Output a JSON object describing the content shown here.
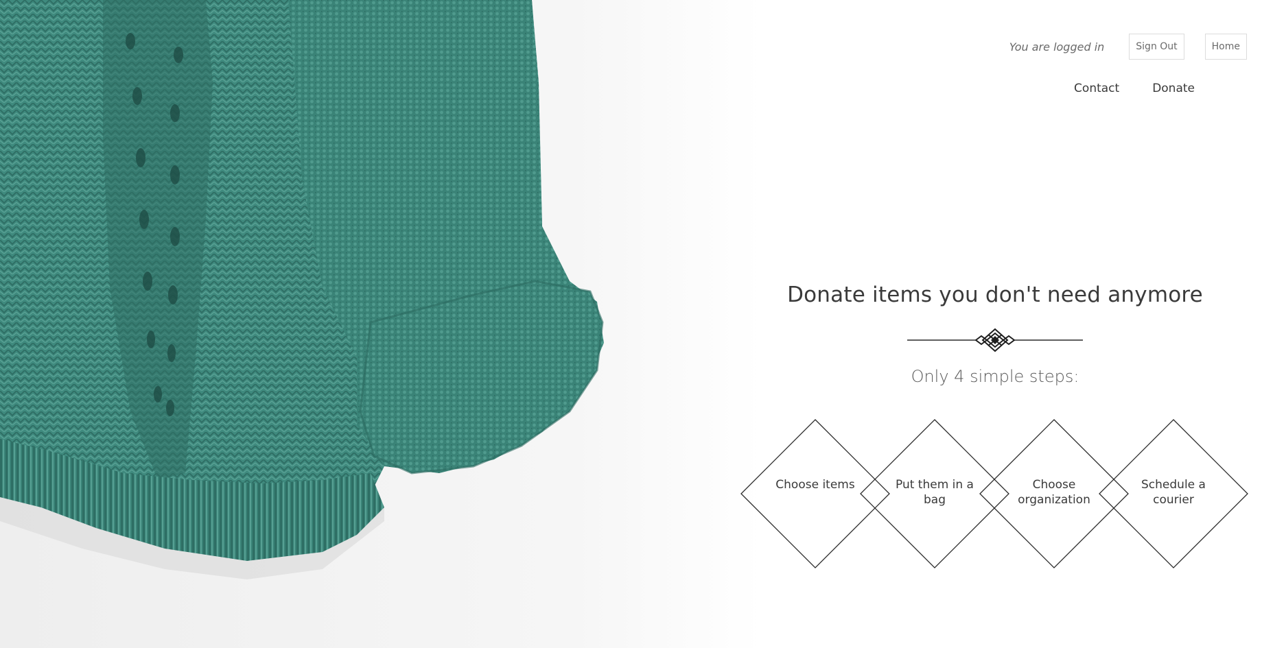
{
  "header": {
    "login_status": "You are logged in",
    "sign_out_label": "Sign Out",
    "home_label": "Home",
    "nav": [
      {
        "label": "Contact"
      },
      {
        "label": "Donate"
      }
    ]
  },
  "hero": {
    "title": "Donate items you don't need anymore",
    "subtitle": "Only 4 simple steps:",
    "steps": [
      {
        "label": "Choose items"
      },
      {
        "label": "Put them in a bag"
      },
      {
        "label": "Choose organization"
      },
      {
        "label": "Schedule a courier"
      }
    ]
  },
  "colors": {
    "sweater": "#3f8a7e",
    "sweater_dark": "#2c6b61",
    "text": "#3a3a3a",
    "muted": "#6a6a6a",
    "line": "#2a2a2a"
  }
}
